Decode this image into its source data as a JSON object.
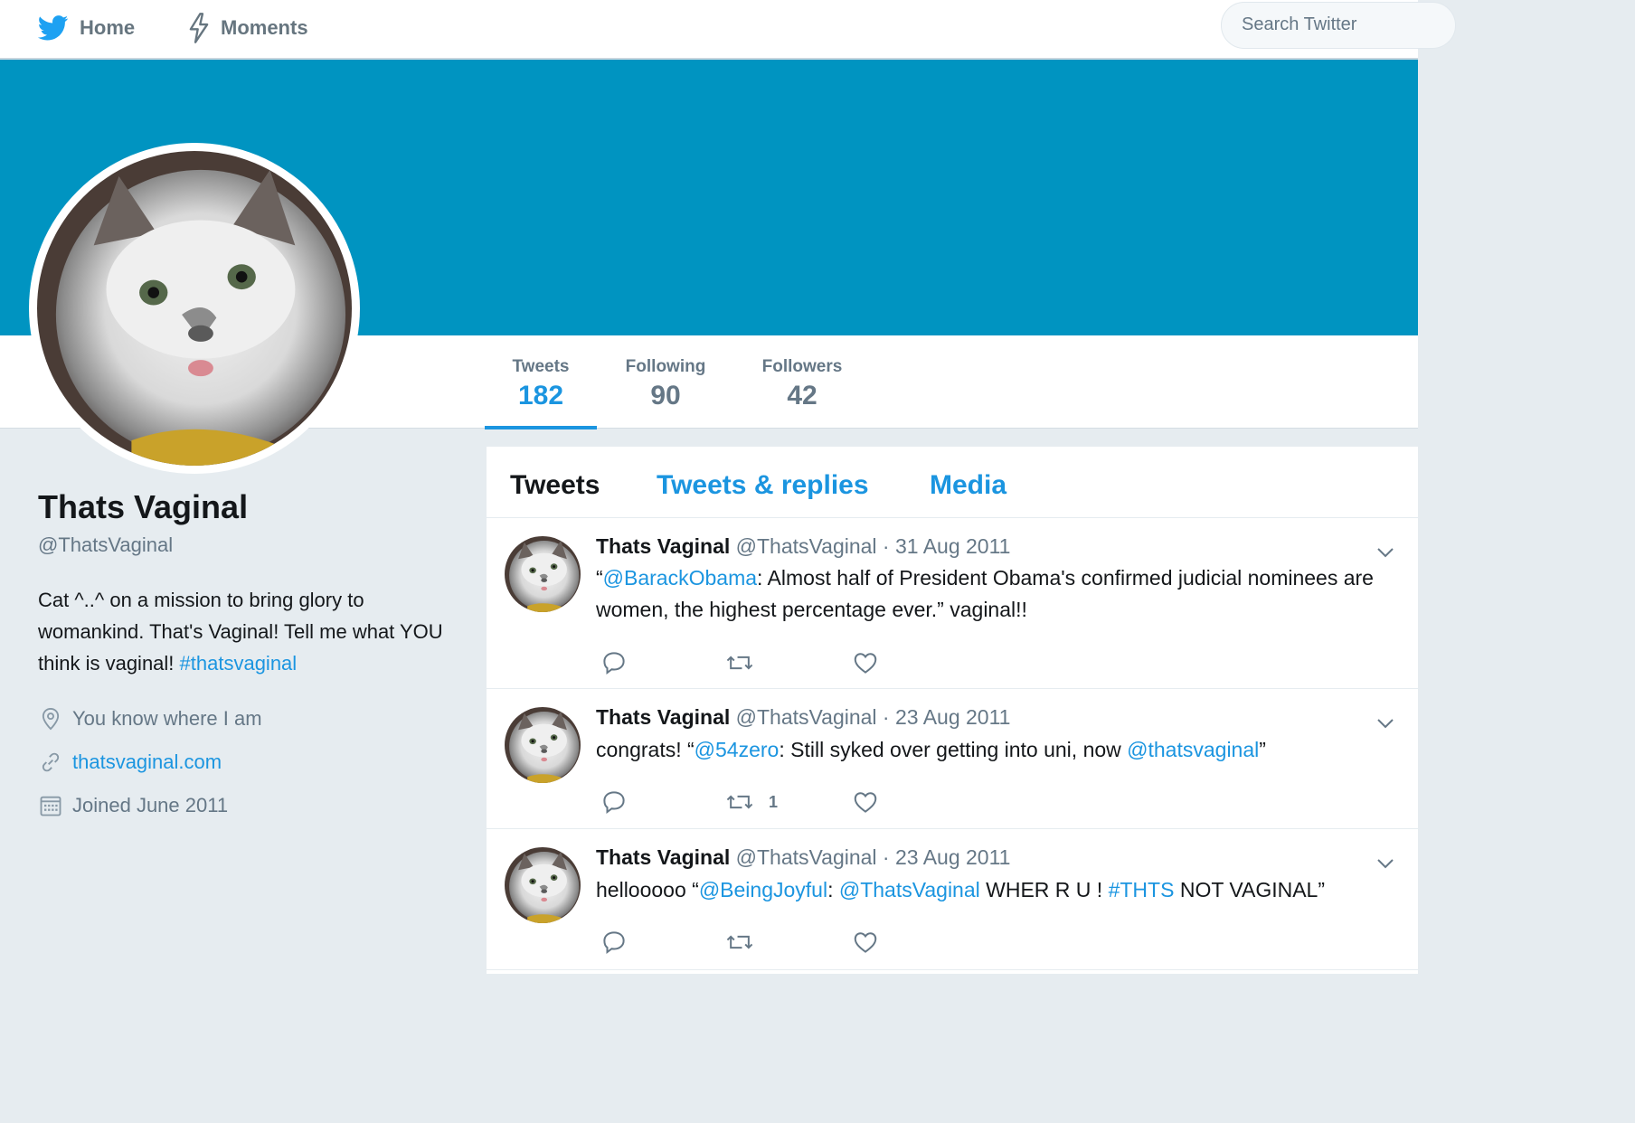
{
  "nav": {
    "home_label": "Home",
    "moments_label": "Moments",
    "search_placeholder": "Search Twitter"
  },
  "colors": {
    "accent": "#1b95e0",
    "banner": "#0094c1"
  },
  "stats": [
    {
      "label": "Tweets",
      "value": "182"
    },
    {
      "label": "Following",
      "value": "90"
    },
    {
      "label": "Followers",
      "value": "42"
    }
  ],
  "profile": {
    "name": "Thats Vaginal",
    "handle": "@ThatsVaginal",
    "bio_text": "Cat ^..^ on a mission to bring glory to womankind. That's Vaginal! Tell me what YOU think is vaginal! ",
    "bio_hashtag": "#thatsvaginal",
    "location": "You know where I am",
    "website": "thatsvaginal.com",
    "joined": "Joined June 2011"
  },
  "tabs": {
    "tweets": "Tweets",
    "replies": "Tweets & replies",
    "media": "Media"
  },
  "tweets": [
    {
      "name": "Thats Vaginal",
      "meta": "@ThatsVaginal · 31 Aug 2011",
      "t1": "“",
      "m1": "@BarackObama",
      "t2": ": Almost half of President Obama's confirmed judicial nominees are women, the highest percentage ever.” vaginal!!",
      "retweets": ""
    },
    {
      "name": "Thats Vaginal",
      "meta": "@ThatsVaginal · 23 Aug 2011",
      "t1": "congrats! “",
      "m1": "@54zero",
      "t2": ": Still syked over getting into uni, now ",
      "m2": "@thatsvaginal",
      "t3": "”",
      "retweets": "1"
    },
    {
      "name": "Thats Vaginal",
      "meta": "@ThatsVaginal · 23 Aug 2011",
      "t1": "hellooooo “",
      "m1": "@BeingJoyful",
      "t2": ": ",
      "m2": "@ThatsVaginal",
      "t3": " WHER R U ! ",
      "m3": "#THTS",
      "t4": " NOT VAGINAL”",
      "retweets": ""
    }
  ]
}
